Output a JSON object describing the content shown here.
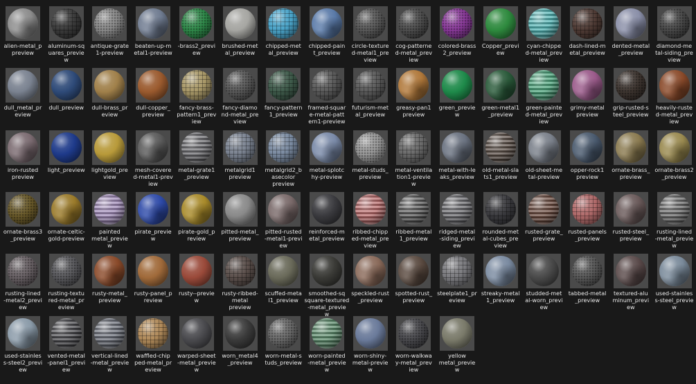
{
  "items": [
    {
      "label": "alien-metal_p\npreview",
      "color": "#8c8c8c",
      "pattern": "noise"
    },
    {
      "label": "aluminum-sq\nuares_previe\nw",
      "color": "#3a3a3a",
      "pattern": "grid"
    },
    {
      "label": "antique-grate\n1-preview",
      "color": "#8a8a8a",
      "pattern": "dots"
    },
    {
      "label": "beaten-up-m\netal1-preview",
      "color": "#6f7b90",
      "pattern": "noise"
    },
    {
      "label": "-brass2_previ\new",
      "color": "#2f8a4a",
      "pattern": "dots"
    },
    {
      "label": "brushed-met\nal_preview",
      "color": "#a6a6a2",
      "pattern": "none"
    },
    {
      "label": "chipped-met\nal_preview",
      "color": "#4aa3c8",
      "pattern": "grid"
    },
    {
      "label": "chipped-pain\nt_preview",
      "color": "#5a7aa8",
      "pattern": "noise"
    },
    {
      "label": "circle-texture\nd-metal1_pre\nview",
      "color": "#5a5a5a",
      "pattern": "dots"
    },
    {
      "label": "cog-patterne\nd-metal_prev\niew",
      "color": "#4f4f4f",
      "pattern": "dots"
    },
    {
      "label": "colored-brass\n2_preview",
      "color": "#8a3a9a",
      "pattern": "dots"
    },
    {
      "label": "Copper_previ\new",
      "color": "#2e8a3e",
      "pattern": "none"
    },
    {
      "label": "cyan-chippe\nd-metal_prev\niew",
      "color": "#4fb3b3",
      "pattern": "stripes"
    },
    {
      "label": "dash-lined-m\netal_preview",
      "color": "#4e3a34",
      "pattern": "grid"
    },
    {
      "label": "dented-metal\n_preview",
      "color": "#8a8fa8",
      "pattern": "noise"
    },
    {
      "label": "diamond-me\ntal-siding_pre\nview",
      "color": "#4a4a4a",
      "pattern": "dots"
    },
    {
      "label": "dull_metal_pr\neview",
      "color": "#7a8290",
      "pattern": "none"
    },
    {
      "label": "dull_preview",
      "color": "#2e4a78",
      "pattern": "none"
    },
    {
      "label": "dull-brass_pr\neview",
      "color": "#a0804a",
      "pattern": "none"
    },
    {
      "label": "dull-copper_\npreview",
      "color": "#9a5a2e",
      "pattern": "none"
    },
    {
      "label": "fancy-brass-\npattern1_prev\niew",
      "color": "#a89868",
      "pattern": "grid"
    },
    {
      "label": "fancy-diamo\nnd-metal_pre\nview",
      "color": "#5a5a5a",
      "pattern": "dots"
    },
    {
      "label": "fancy-pattern\n1_preview",
      "color": "#3e5a4a",
      "pattern": "grid"
    },
    {
      "label": "framed-squar\ne-metal-patt\nern1-preview",
      "color": "#5a5a5a",
      "pattern": "grid"
    },
    {
      "label": "futurism-met\nal_preview",
      "color": "#5a5a5a",
      "pattern": "grid"
    },
    {
      "label": "greasy-pan1\npreview",
      "color": "#b0783a",
      "pattern": "noise"
    },
    {
      "label": "green_previe\nw",
      "color": "#1e8a4a",
      "pattern": "none"
    },
    {
      "label": "green-metal1\n_preview",
      "color": "#2a5a3a",
      "pattern": "noise"
    },
    {
      "label": "green-painte\nd-metal_prev\niew",
      "color": "#4aa37a",
      "pattern": "stripes"
    },
    {
      "label": "grimy-metal\npreview",
      "color": "#9a5a8a",
      "pattern": "noise"
    },
    {
      "label": "grip-rusted-s\nteel_preview",
      "color": "#3e3530",
      "pattern": "dots"
    },
    {
      "label": "heavily-ruste\nd-metal_prev\niew",
      "color": "#8a4a2a",
      "pattern": "noise"
    },
    {
      "label": "iron-rusted\npreview",
      "color": "#7a6a70",
      "pattern": "noise"
    },
    {
      "label": "light_preview",
      "color": "#1e3a8a",
      "pattern": "none"
    },
    {
      "label": "lightgold_pre\nview",
      "color": "#b89a3a",
      "pattern": "none"
    },
    {
      "label": "mesh-covere\nd-metal1-prev\niew",
      "color": "#5a5a5a",
      "pattern": "noise"
    },
    {
      "label": "metal-grate1\n_preview",
      "color": "#6a6a6e",
      "pattern": "stripes"
    },
    {
      "label": "metalgrid1\npreview",
      "color": "#7a8290",
      "pattern": "grid"
    },
    {
      "label": "metalgrid2_b\nasecolor\npreview",
      "color": "#7a8aa0",
      "pattern": "grid"
    },
    {
      "label": "metal-splotc\nhy-preview",
      "color": "#7a8aa8",
      "pattern": "noise"
    },
    {
      "label": "metal-studs_\npreview",
      "color": "#9a9a9a",
      "pattern": "dots"
    },
    {
      "label": "metal-ventila\ntion1-previe\nw",
      "color": "#6a6a6a",
      "pattern": "grid"
    },
    {
      "label": "metal-with-le\naks_preview",
      "color": "#6a7280",
      "pattern": "noise"
    },
    {
      "label": "old-metal-sla\nts1_preview",
      "color": "#5a4e46",
      "pattern": "stripes"
    },
    {
      "label": "old-sheet-me\ntal-preview",
      "color": "#7a808a",
      "pattern": "noise"
    },
    {
      "label": "opper-rock1\npreview",
      "color": "#4a5a6e",
      "pattern": "noise"
    },
    {
      "label": "ornate-brass_\npreview",
      "color": "#8a7a50",
      "pattern": "noise"
    },
    {
      "label": "ornate-brass2\n_preview",
      "color": "#9a8a50",
      "pattern": "noise"
    },
    {
      "label": "ornate-brass3\n_preview",
      "color": "#6a5a2a",
      "pattern": "dots"
    },
    {
      "label": "ornate-celtic-\ngold-preview",
      "color": "#9a7a2a",
      "pattern": "noise"
    },
    {
      "label": "painted\nmetal_previe\nw",
      "color": "#a08ab8",
      "pattern": "stripes"
    },
    {
      "label": "pirate_previe\nw",
      "color": "#2e4aa8",
      "pattern": "noise"
    },
    {
      "label": "pirate-gold_p\nreview",
      "color": "#a88a2a",
      "pattern": "noise"
    },
    {
      "label": "pitted-metal_\npreview",
      "color": "#8a8a8a",
      "pattern": "none"
    },
    {
      "label": "pitted-rusted\n-metal1-previ\new",
      "color": "#7a6a6a",
      "pattern": "noise"
    },
    {
      "label": "reinforced-m\netal_preview",
      "color": "#3a3a3e",
      "pattern": "none"
    },
    {
      "label": "ribbed-chipp\ned-metal_pre\nview",
      "color": "#b86a6a",
      "pattern": "stripes"
    },
    {
      "label": "ribbed-metal\n1_preview",
      "color": "#5a5a5a",
      "pattern": "stripes"
    },
    {
      "label": "ridged-metal\n-siding_previ\new",
      "color": "#6a6a6e",
      "pattern": "stripes"
    },
    {
      "label": "rounded-met\nal-cubes_pre\nview",
      "color": "#3a3a3e",
      "pattern": "grid"
    },
    {
      "label": "rusted-grate_\npreview",
      "color": "#6a4a3e",
      "pattern": "stripes"
    },
    {
      "label": "rusted-panels\n_preview",
      "color": "#b06a6a",
      "pattern": "grid"
    },
    {
      "label": "rusted-steel_\npreview",
      "color": "#6a5a5a",
      "pattern": "noise"
    },
    {
      "label": "rusting-lined\n-metal_previe\nw",
      "color": "#6a6a6a",
      "pattern": "stripes"
    },
    {
      "label": "rusting-lined\n-metal2_previ\new",
      "color": "#6a6266",
      "pattern": "dots"
    },
    {
      "label": "rusting-textu\nred-metal_pr\neview",
      "color": "#5a5a5e",
      "pattern": "dots"
    },
    {
      "label": "rusty-metal_\npreview",
      "color": "#8a4a2a",
      "pattern": "noise"
    },
    {
      "label": "rusty-panel_p\nreview",
      "color": "#a06a3a",
      "pattern": "none"
    },
    {
      "label": "rusty--previe\nw",
      "color": "#9a4a3a",
      "pattern": "none"
    },
    {
      "label": "rusty-ribbed-\nmetal\npreview",
      "color": "#5a4e4a",
      "pattern": "grid"
    },
    {
      "label": "scuffed-meta\nl1_preview",
      "color": "#6a6a5a",
      "pattern": "none"
    },
    {
      "label": "smoothed-sq\nsquare-textured\n-metal_previe\nw",
      "color": "#3a3a36",
      "pattern": "none"
    },
    {
      "label": "speckled-rust\n_preview",
      "color": "#8a6a5a",
      "pattern": "noise"
    },
    {
      "label": "spotted-rust_\npreview",
      "color": "#5a4a40",
      "pattern": "noise"
    },
    {
      "label": "steelplate1_pr\neview",
      "color": "#7a7a7e",
      "pattern": "grid"
    },
    {
      "label": "streaky-metal\n1_preview",
      "color": "#7a8aa0",
      "pattern": "noise"
    },
    {
      "label": "studded-met\nal-worn_previ\new",
      "color": "#4a4a4a",
      "pattern": "none"
    },
    {
      "label": "tabbed-metal\n_preview",
      "color": "#5a5a5a",
      "pattern": "dots"
    },
    {
      "label": "textured-alu\nminum_previ\new",
      "color": "#5a4a4a",
      "pattern": "noise"
    },
    {
      "label": "used-stainles\ns-steel_previe\nw",
      "color": "#7a8a9a",
      "pattern": "noise"
    },
    {
      "label": "used-stainles\ns-steel2_previ\new",
      "color": "#8a9aa8",
      "pattern": "noise"
    },
    {
      "label": "vented-metal\n-panel1_previ\new",
      "color": "#4a4a4e",
      "pattern": "stripes"
    },
    {
      "label": "vertical-lined\n-metal_previe\nw",
      "color": "#6a6e78",
      "pattern": "stripes"
    },
    {
      "label": "waffled-chip\nped-metal_pr\neview",
      "color": "#b08a5a",
      "pattern": "grid"
    },
    {
      "label": "warped-sheet\n-metal_previe\nw",
      "color": "#4a4a4e",
      "pattern": "none"
    },
    {
      "label": "worn_metal4\n_preview",
      "color": "#3a3a3a",
      "pattern": "none"
    },
    {
      "label": "worn-metal-s\ntuds_preview",
      "color": "#6a6a6a",
      "pattern": "dots"
    },
    {
      "label": "worn-painted\n-metal_previe\nw",
      "color": "#5a8a6a",
      "pattern": "stripes"
    },
    {
      "label": "worn-shiny-\nmetal-previe\nw",
      "color": "#6a7a9a",
      "pattern": "none"
    },
    {
      "label": "worn-walkwa\ny-metal_prev\niew",
      "color": "#4a4a4e",
      "pattern": "dots"
    },
    {
      "label": "yellow\nmetal_previe\nw",
      "color": "#7a7a6a",
      "pattern": "none"
    }
  ]
}
